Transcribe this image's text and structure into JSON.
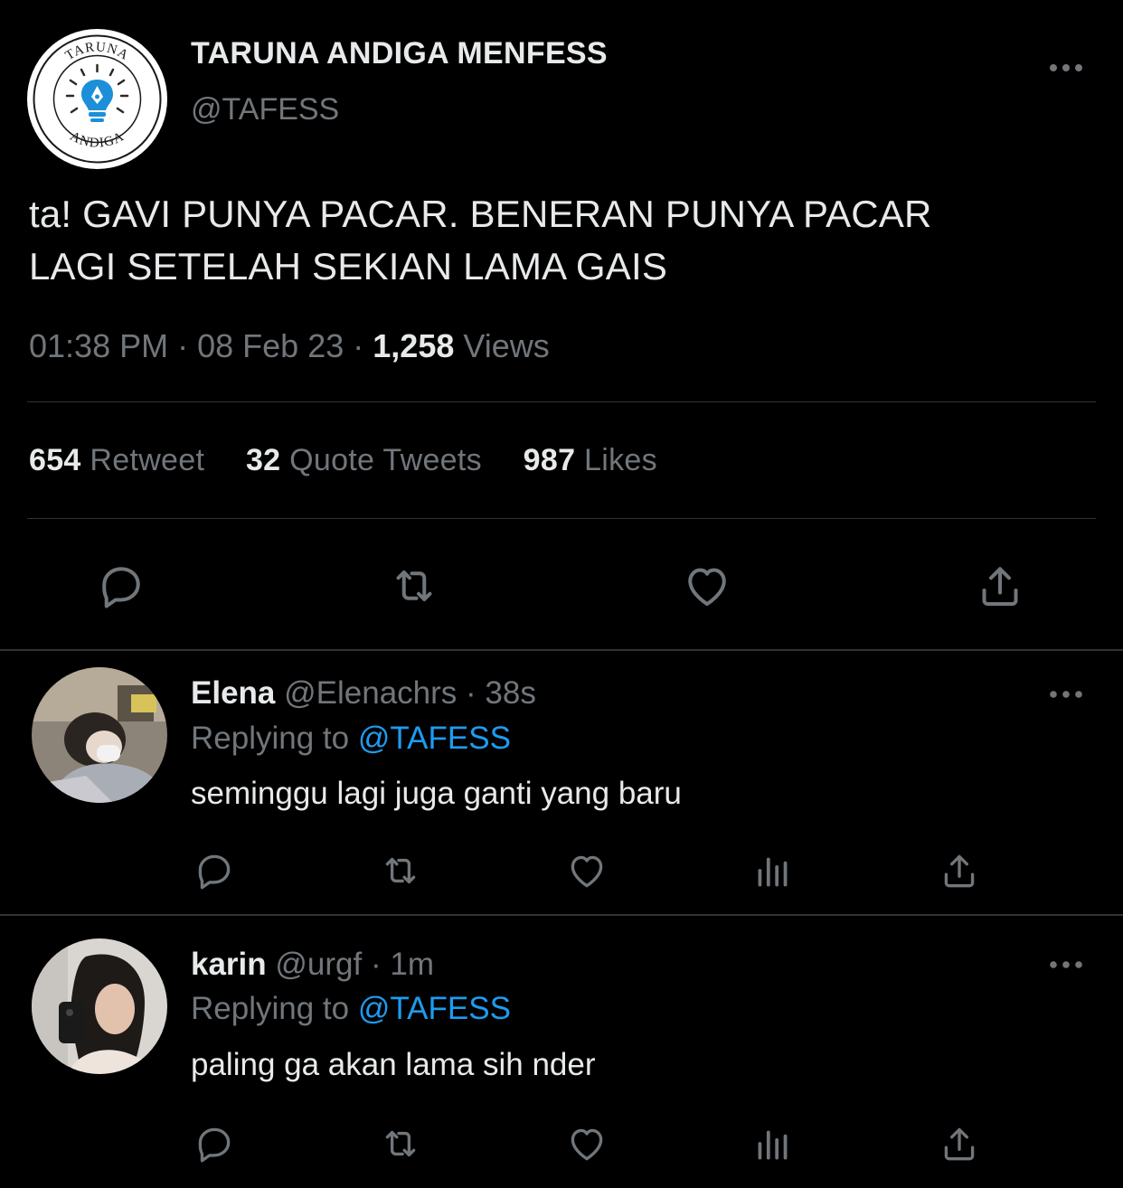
{
  "tweet": {
    "author_name": "TARUNA ANDIGA MENFESS",
    "author_handle": "@TAFESS",
    "logo_text_top": "TARUNA",
    "logo_text_bottom": "ANDIGA",
    "text_line1": "ta! GAVI PUNYA PACAR. BENERAN PUNYA PACAR",
    "text_line2": "LAGI SETELAH SEKIAN LAMA GAIS",
    "time": "01:38 PM",
    "date": "08 Feb 23",
    "views_count": "1,258",
    "views_label": "Views",
    "separator": "·",
    "stats": {
      "retweets": "654",
      "retweets_label": "Retweet",
      "quotes": "32",
      "quotes_label": "Quote Tweets",
      "likes": "987",
      "likes_label": "Likes"
    }
  },
  "replies": [
    {
      "name": "Elena",
      "handle": "@Elenachrs",
      "time": "38s",
      "replying_label": "Replying to",
      "replying_to": "@TAFESS",
      "text": "seminggu lagi juga ganti yang baru"
    },
    {
      "name": "karin",
      "handle": "@urgf",
      "time": "1m",
      "replying_label": "Replying to",
      "replying_to": "@TAFESS",
      "text": "paling ga akan lama sih nder"
    }
  ],
  "colors": {
    "background": "#000000",
    "text": "#e7e9ea",
    "muted": "#71767b",
    "link": "#1d9bf0",
    "divider": "#2f3336"
  },
  "icons": [
    "more-icon",
    "reply-icon",
    "retweet-icon",
    "like-icon",
    "share-icon",
    "analytics-icon"
  ]
}
